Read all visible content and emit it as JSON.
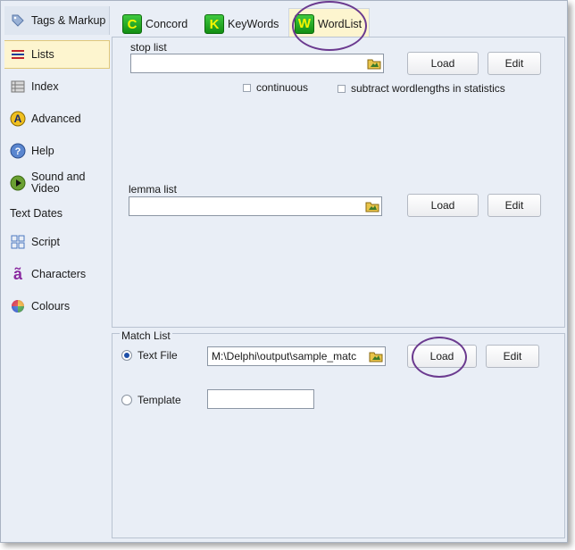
{
  "sidebar": {
    "items": [
      {
        "label": "Tags & Markup",
        "icon": "tag-icon"
      },
      {
        "label": "Lists",
        "icon": "list-icon"
      },
      {
        "label": "Index",
        "icon": "index-icon"
      },
      {
        "label": "Advanced",
        "icon": "advanced-icon"
      },
      {
        "label": "Help",
        "icon": "help-icon"
      },
      {
        "label": "Sound and Video",
        "icon": "play-icon"
      },
      {
        "label": "Text Dates",
        "icon": ""
      },
      {
        "label": "Script",
        "icon": "script-icon"
      },
      {
        "label": "Characters",
        "icon": "characters-icon"
      },
      {
        "label": "Colours",
        "icon": "colours-icon"
      }
    ],
    "active": "Lists"
  },
  "tabs": [
    {
      "label": "Concord",
      "letter": "C"
    },
    {
      "label": "KeyWords",
      "letter": "K"
    },
    {
      "label": "WordList",
      "letter": "W"
    }
  ],
  "active_tab": "WordList",
  "stop_list": {
    "label": "stop list",
    "value": "",
    "load": "Load",
    "edit": "Edit"
  },
  "options": {
    "continuous": "continuous",
    "subtract": "subtract wordlengths in statistics"
  },
  "lemma_list": {
    "label": "lemma list",
    "value": "",
    "load": "Load",
    "edit": "Edit"
  },
  "match_list": {
    "legend": "Match List",
    "text_file_label": "Text File",
    "text_file_value": "M:\\Delphi\\output\\sample_matc",
    "template_label": "Template",
    "template_value": "",
    "load": "Load",
    "edit": "Edit",
    "selected": "Text File"
  },
  "colors": {
    "highlight_circle": "#6b3a8f",
    "active_bg": "#fdf5cf",
    "tab_icon_green": "#2aa82a",
    "tab_icon_letter": "#f5f500"
  }
}
